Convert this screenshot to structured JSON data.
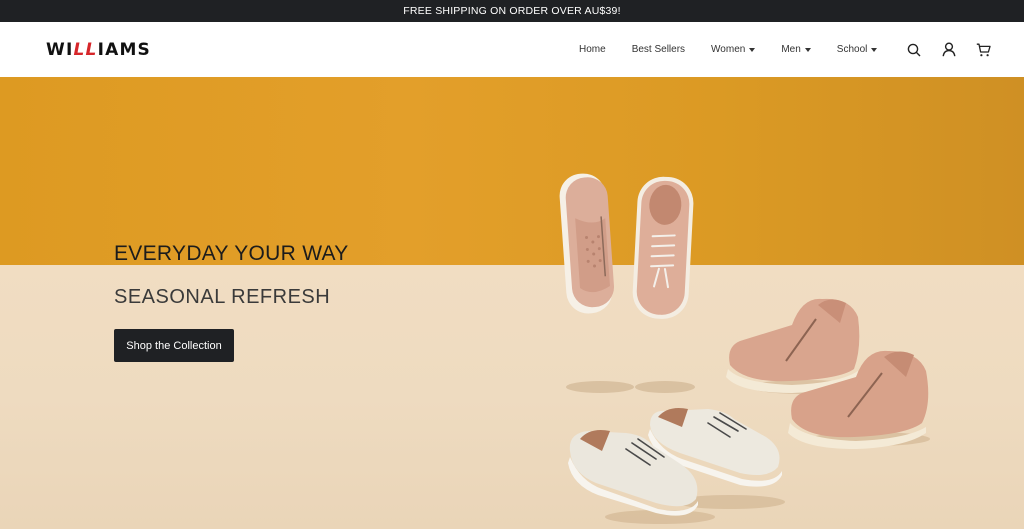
{
  "announcement": "FREE SHIPPING ON ORDER OVER AU$39!",
  "brand": {
    "pre": "WI",
    "mid": "LL",
    "post": "IAMS"
  },
  "nav": [
    {
      "label": "Home",
      "dropdown": false
    },
    {
      "label": "Best Sellers",
      "dropdown": false
    },
    {
      "label": "Women",
      "dropdown": true
    },
    {
      "label": "Men",
      "dropdown": true
    },
    {
      "label": "School",
      "dropdown": true
    }
  ],
  "icons": [
    "search-icon",
    "user-icon",
    "cart-icon"
  ],
  "hero": {
    "title": "EVERYDAY YOUR WAY",
    "subtitle": "SEASONAL REFRESH",
    "cta": "Shop the Collection"
  },
  "colors": {
    "announcement_bg": "#1f2124",
    "wall": "#e09d27",
    "floor": "#efdbc0",
    "cta_bg": "#1f2124",
    "brand_accent": "#d6262a"
  }
}
